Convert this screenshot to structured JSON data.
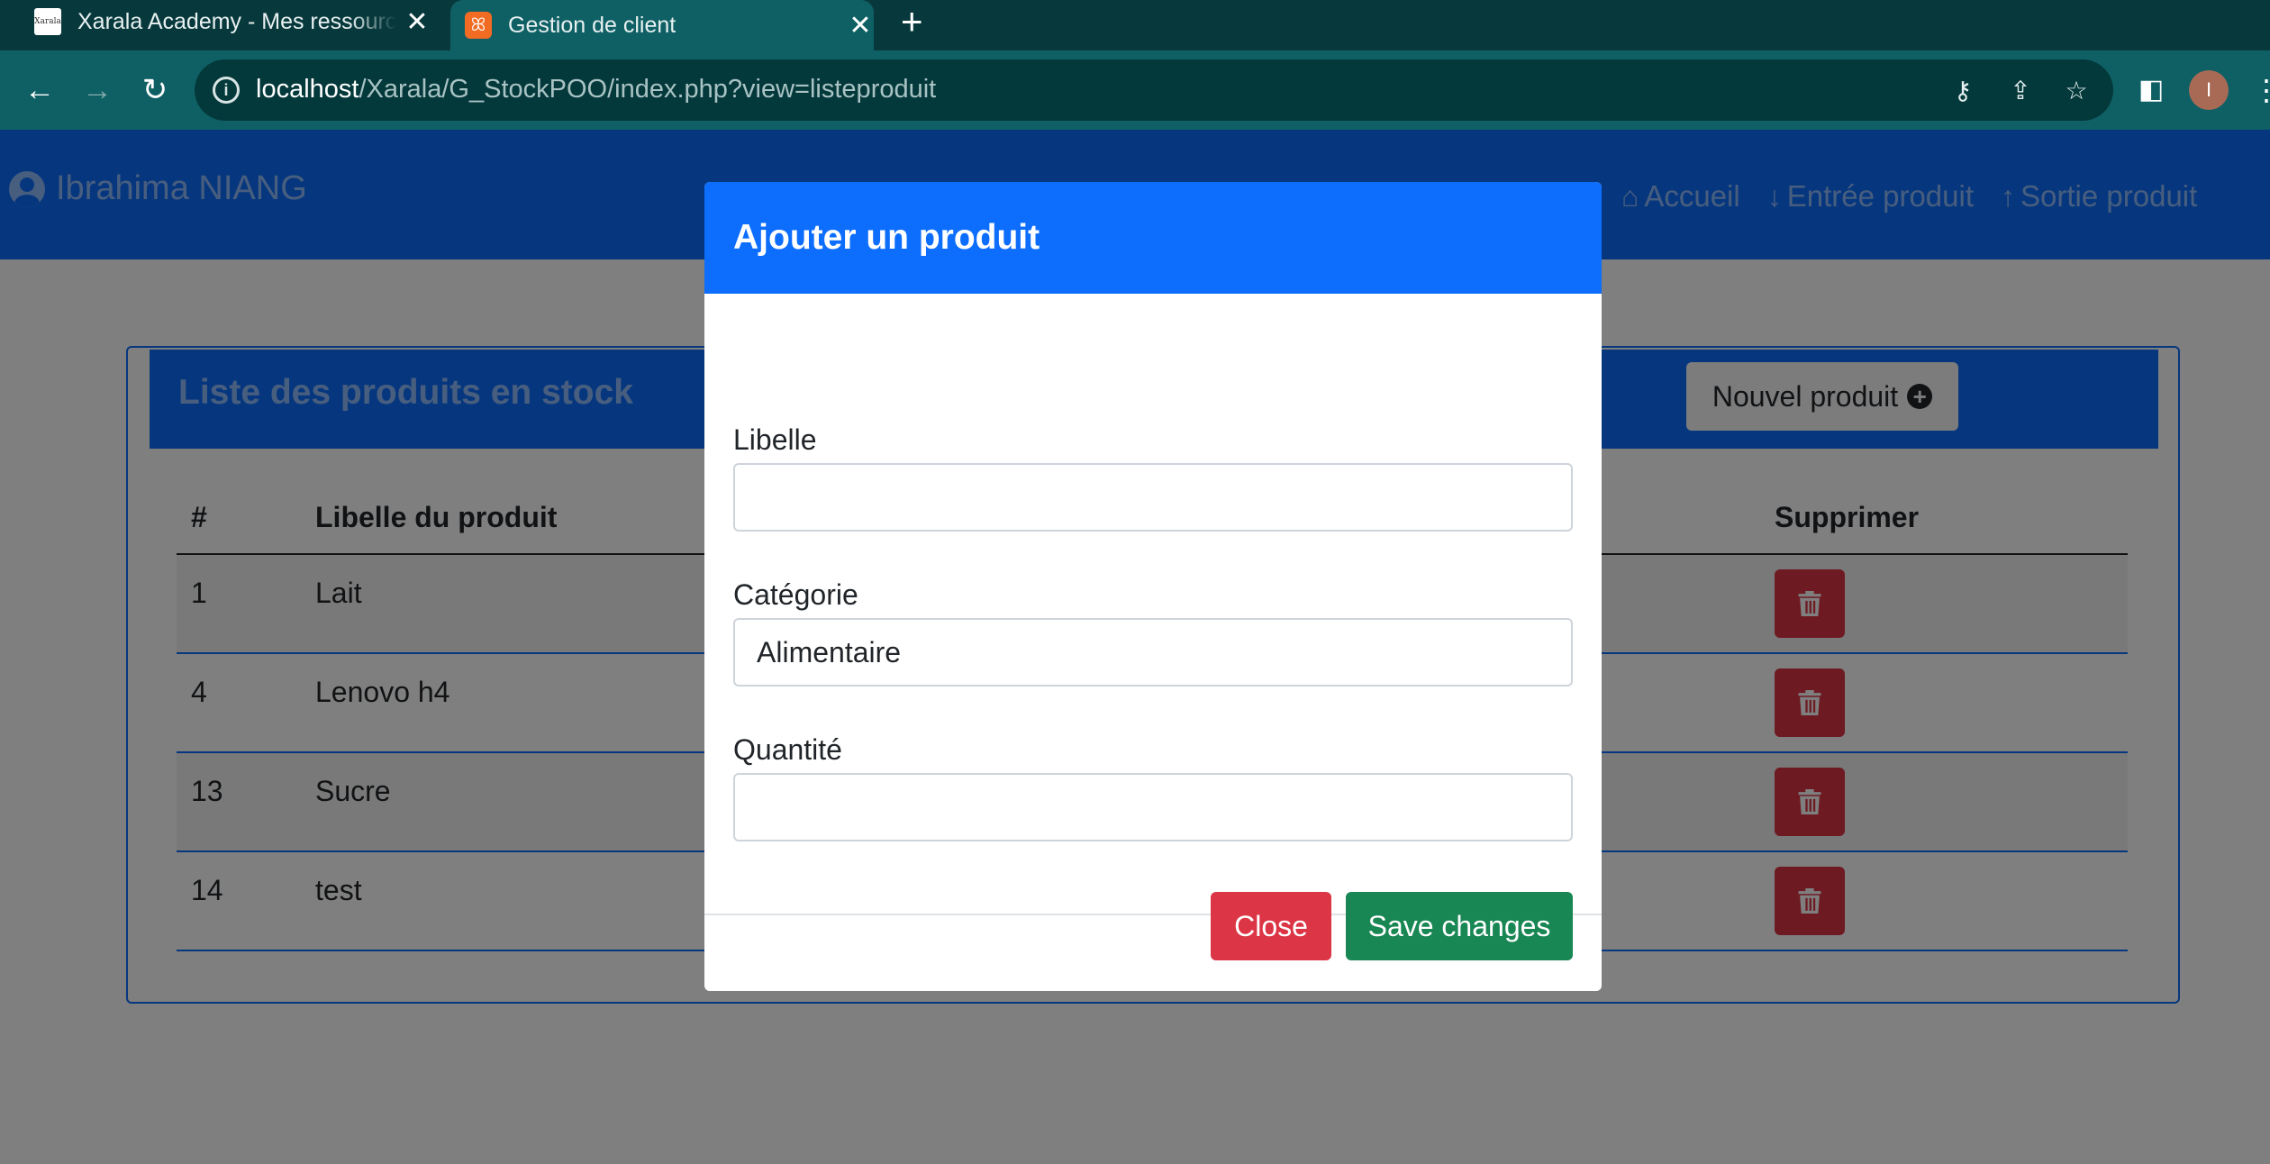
{
  "browser": {
    "tabs": [
      {
        "title": "Xarala Academy - Mes ressources",
        "favicon_text": "Xarala",
        "active": false
      },
      {
        "title": "Gestion de client",
        "favicon_text": "ꕤ",
        "active": true
      }
    ],
    "new_tab_glyph": "+",
    "close_glyph": "✕",
    "url_host": "localhost",
    "url_path": "/Xarala/G_StockPOO/index.php?view=listeproduit",
    "profile_initial": "I"
  },
  "navbar": {
    "brand": "Ibrahima NIANG",
    "links": [
      {
        "label": "Accueil",
        "icon": "home-icon"
      },
      {
        "label": "Entrée produit",
        "icon": "arrow-down-icon"
      },
      {
        "label": "Sortie produit",
        "icon": "arrow-up-icon"
      }
    ]
  },
  "card": {
    "title": "Liste des produits en stock",
    "new_button": "Nouvel produit",
    "headers": {
      "id": "#",
      "name": "Libelle du produit",
      "delete": "Supprimer"
    },
    "rows": [
      {
        "id": "1",
        "name": "Lait"
      },
      {
        "id": "4",
        "name": "Lenovo h4"
      },
      {
        "id": "13",
        "name": "Sucre"
      },
      {
        "id": "14",
        "name": "test"
      }
    ]
  },
  "modal": {
    "title": "Ajouter un produit",
    "fields": {
      "libelle_label": "Libelle",
      "libelle_value": "",
      "categorie_label": "Catégorie",
      "categorie_value": "Alimentaire",
      "quantite_label": "Quantité",
      "quantite_value": ""
    },
    "close_button": "Close",
    "save_button": "Save changes"
  },
  "colors": {
    "primary": "#0d6efd",
    "danger": "#dc3545",
    "success": "#198754",
    "chrome_dark": "#07393c",
    "chrome_toolbar": "#0e6065"
  }
}
